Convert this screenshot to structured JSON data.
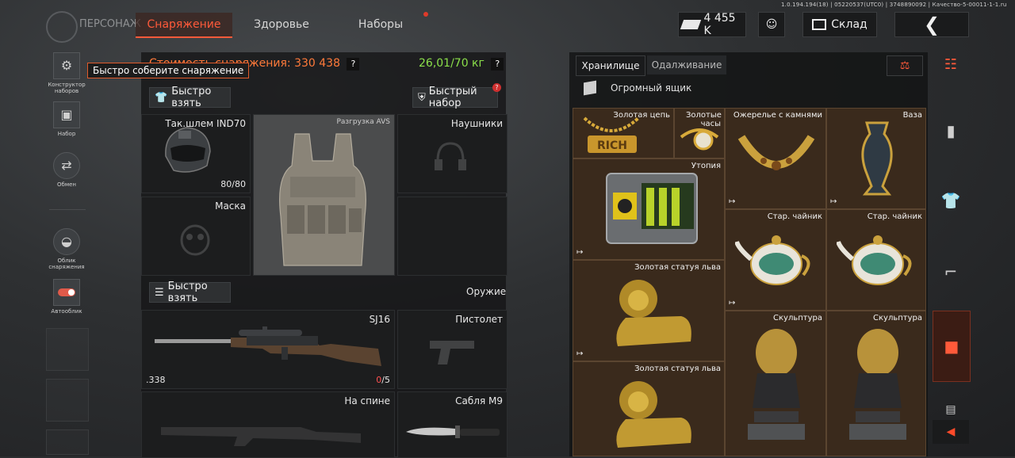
{
  "system_info": "1.0.194.194(18) | 05220537(UTC0) | 3748890092 | Качество-5-00011-1-1.ru",
  "header": {
    "title": "ПЕРСОНАЖ",
    "tabs": [
      {
        "label": "Снаряжение",
        "active": true
      },
      {
        "label": "Здоровье",
        "active": false
      },
      {
        "label": "Наборы",
        "active": false
      }
    ],
    "money": "4 455 K",
    "warehouse_label": "Склад"
  },
  "left_rail": {
    "items": [
      {
        "label": "Конструктор наборов",
        "icon": "constructor-icon"
      },
      {
        "label": "Набор",
        "icon": "gift-icon"
      },
      {
        "label": "Обмен",
        "icon": "exchange-icon"
      },
      {
        "label": "Облик снаряжения",
        "icon": "helmet-icon"
      },
      {
        "label": "Автооблик",
        "icon": "toggle-icon"
      }
    ],
    "tooltip": "Быстро соберите снаряжение"
  },
  "equipment": {
    "cost_label": "Стоимость снаряжения:",
    "cost_value": "330 438",
    "weight": "26,01/70 кг",
    "help": "?",
    "quick_take": "Быстро взять",
    "quick_set": "Быстрый набор",
    "quick_set_badge": "?",
    "slots": {
      "helmet": {
        "name": "Так.шлем IND70",
        "durability": "80/80"
      },
      "vest": {
        "name": "Разгрузка AVS"
      },
      "headphones": {
        "name": "Наушники"
      },
      "mask": {
        "name": "Маска"
      }
    },
    "weapons_label": "Оружие",
    "quick_take_weapons": "Быстро взять",
    "primary": {
      "name": "SJ16",
      "caliber": ".338",
      "ammo_loaded": "0",
      "ammo_sep": "/5"
    },
    "pistol": {
      "name": "Пистолет"
    },
    "back": {
      "name": "На спине"
    },
    "melee": {
      "name": "Сабля M9"
    }
  },
  "storage": {
    "tabs": [
      {
        "label": "Хранилище",
        "active": true
      },
      {
        "label": "Одалживание",
        "active": false
      }
    ],
    "container_name": "Огромный ящик",
    "items": [
      {
        "name": "Золотая цепь",
        "icon": "gold-chain-icon"
      },
      {
        "name": "Золотые часы",
        "icon": "gold-watch-icon"
      },
      {
        "name": "Ожерелье с камнями",
        "icon": "necklace-icon"
      },
      {
        "name": "Ваза",
        "icon": "vase-icon"
      },
      {
        "name": "Утопия",
        "icon": "utopia-case-icon"
      },
      {
        "name": "Стар. чайник",
        "icon": "teapot-icon"
      },
      {
        "name": "Стар. чайник",
        "icon": "teapot-icon"
      },
      {
        "name": "Золотая статуя льва",
        "icon": "lion-statue-icon"
      },
      {
        "name": "Скульптура",
        "icon": "sculpture-icon"
      },
      {
        "name": "Скульптура",
        "icon": "sculpture-icon"
      },
      {
        "name": "Золотая статуя льва",
        "icon": "lion-statue-icon"
      }
    ]
  },
  "colors": {
    "accent": "#ff5a3a",
    "weight": "#8be04a",
    "cost": "#ff7a3a",
    "storage_cell": "#3a2a1c"
  }
}
